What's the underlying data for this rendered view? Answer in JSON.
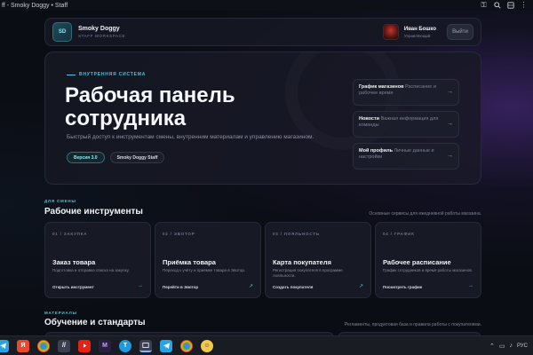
{
  "browser": {
    "title": "ff - Smoky Doggy • Staff",
    "icons": [
      "key-icon",
      "search-icon",
      "extensions-icon",
      "more-icon"
    ]
  },
  "header": {
    "logo_text": "SD",
    "brand_name": "Smoky Doggy",
    "brand_sub": "STAFF WORKSPACE",
    "user_name": "Иван Бошко",
    "user_role": "Управляющий",
    "logout_label": "Выйти"
  },
  "hero": {
    "eyebrow": "ВНУТРЕННЯЯ СИСТЕМА",
    "title": "Рабочая панель сотрудника",
    "description": "Быстрый доступ к инструментам смены, внутренним материалам и управлению магазином.",
    "version_pill": "Версия 3.0",
    "staff_pill": "Smoky Doggy Staff",
    "quick_links": [
      {
        "title": "График магазинов",
        "desc": "Расписание и рабочее время"
      },
      {
        "title": "Новости",
        "desc": "Важная информация для команды"
      },
      {
        "title": "Мой профиль",
        "desc": "Личные данные и настройки"
      }
    ]
  },
  "tools_section": {
    "eyebrow": "ДЛЯ СМЕНЫ",
    "title": "Рабочие инструменты",
    "note": "Основные сервисы для ежедневной работы магазина.",
    "cards": [
      {
        "num": "01 / ЗАКУПКА",
        "name": "Заказ товара",
        "desc": "Подготовка и отправка списка на закупку.",
        "link": "Открыть инструмент",
        "arrow": "→"
      },
      {
        "num": "02 / ЭВОТОР",
        "name": "Приёмка товара",
        "desc": "Переход к учёту и приёмке товара в Эвотор.",
        "link": "Перейти в Эвотор",
        "arrow": "↗"
      },
      {
        "num": "03 / ЛОЯЛЬНОСТЬ",
        "name": "Карта покупателя",
        "desc": "Регистрация покупателя в программе лояльности.",
        "link": "Создать покупателя",
        "arrow": "↗"
      },
      {
        "num": "04 / ГРАФИК",
        "name": "Рабочее расписание",
        "desc": "График сотрудников и время работы магазинов.",
        "link": "Посмотреть график",
        "arrow": "→"
      }
    ]
  },
  "materials_section": {
    "eyebrow": "МАТЕРИАЛЫ",
    "title": "Обучение и стандарты",
    "note": "Регламенты, продуктовая база и правила работы с покупателями."
  },
  "taskbar": {
    "apps": [
      "telegram-icon",
      "yandex-icon",
      "chrome-icon",
      "editor-icon",
      "youtube-icon",
      "media-icon",
      "t-app-icon",
      "snipping-icon",
      "telegram-icon",
      "chrome-icon",
      "game-icon"
    ],
    "language": "РУС"
  },
  "colors": {
    "accent": "#49c6d8",
    "background": "#0b0d14"
  }
}
